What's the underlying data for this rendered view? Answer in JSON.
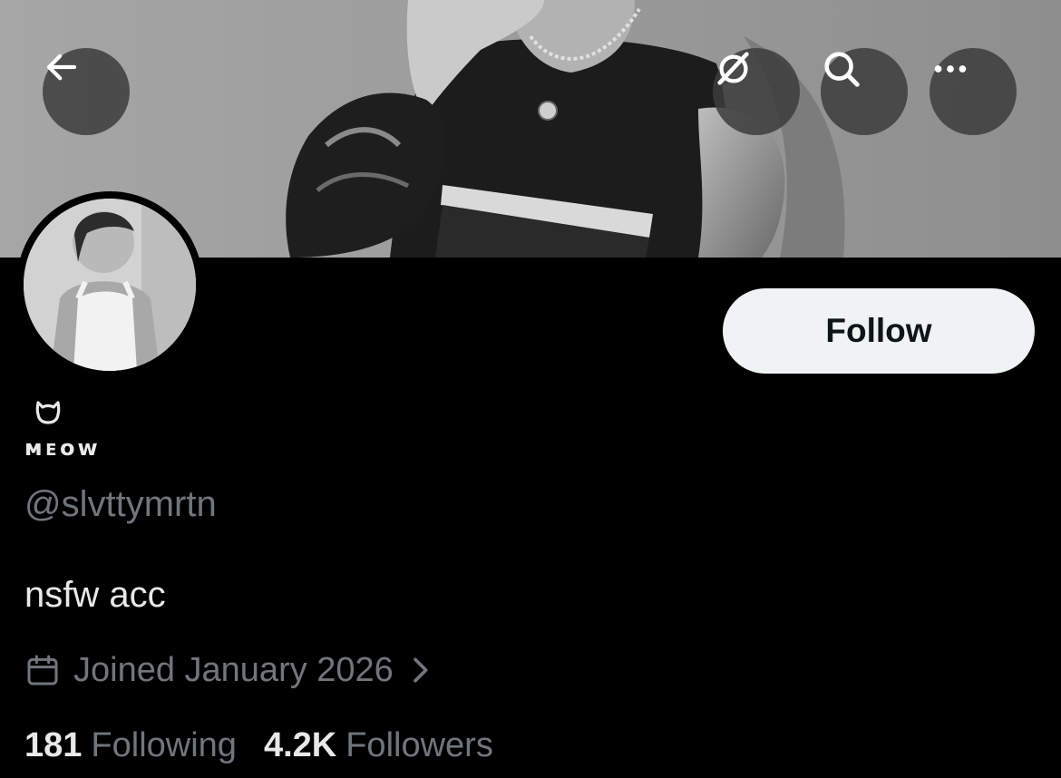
{
  "header": {
    "back_icon": "arrow-left-icon",
    "grok_icon": "grok-icon",
    "search_icon": "search-icon",
    "more_icon": "more-horizontal-icon"
  },
  "profile": {
    "name_emoji": "cat-face",
    "display_name": "ᴍᴇᴏᴡ",
    "handle": "@slvttymrtn",
    "bio": "nsfw acc",
    "joined": "Joined January 2026",
    "follow_label": "Follow"
  },
  "stats": {
    "following_count": "181",
    "following_label": "Following",
    "followers_count": "4.2K",
    "followers_label": "Followers"
  },
  "colors": {
    "background": "#000000",
    "primary_text": "#e7e9ea",
    "secondary_text": "#71767b",
    "follow_button_bg": "#eff3f4",
    "follow_button_text": "#0f1419"
  }
}
